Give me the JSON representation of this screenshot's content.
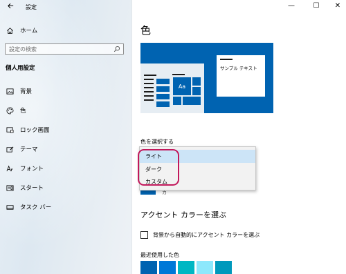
{
  "window": {
    "title": "設定",
    "minimize": "—",
    "maximize": "☐",
    "close": "✕"
  },
  "sidebar": {
    "home_label": "ホーム",
    "search_placeholder": "設定の検索",
    "section_header": "個人用設定",
    "items": [
      {
        "label": "背景",
        "icon": "image-icon"
      },
      {
        "label": "色",
        "icon": "palette-icon"
      },
      {
        "label": "ロック画面",
        "icon": "lock-screen-icon"
      },
      {
        "label": "テーマ",
        "icon": "theme-brush-icon"
      },
      {
        "label": "フォント",
        "icon": "font-icon"
      },
      {
        "label": "スタート",
        "icon": "start-menu-icon"
      },
      {
        "label": "タスク バー",
        "icon": "taskbar-icon"
      }
    ]
  },
  "main": {
    "title": "色",
    "preview": {
      "sample_text": "サンプル テキスト",
      "tile_text": "Aa"
    },
    "choose_color_label": "色を選択する",
    "dropdown_options": [
      {
        "label": "ライト",
        "selected": true
      },
      {
        "label": "ダーク",
        "selected": false
      },
      {
        "label": "カスタム",
        "selected": false
      }
    ],
    "behind_dropdown_text": "カ",
    "accent_heading": "アクセント カラーを選ぶ",
    "auto_accent_label": "背景から自動的にアクセント カラーを選ぶ",
    "auto_accent_checked": false,
    "recent_colors_label": "最近使用した色",
    "recent_colors": [
      "#0063b1",
      "#0078d7",
      "#00b7c3",
      "#8de8fc",
      "#0099bc"
    ]
  },
  "colors": {
    "accent": "#0063b1",
    "highlight_ring": "#c2185b",
    "selected_option": "#cce4f7"
  }
}
